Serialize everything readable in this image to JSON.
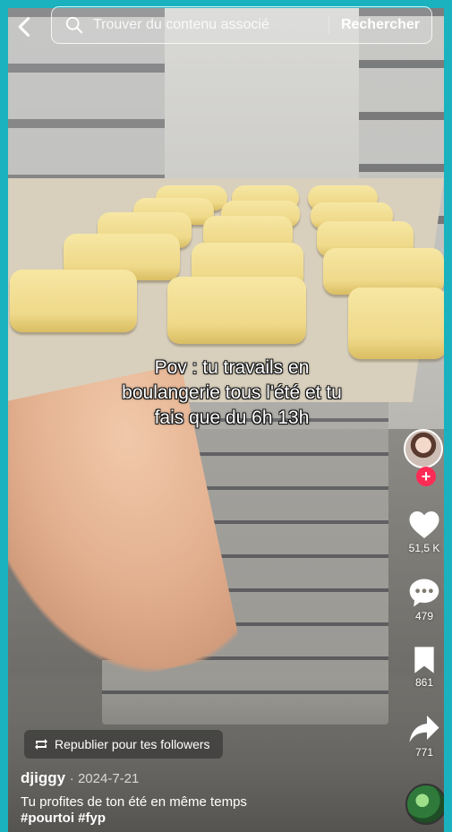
{
  "search": {
    "placeholder": "Trouver du contenu associé",
    "button_label": "Rechercher"
  },
  "video": {
    "caption_lines": [
      "Pov : tu travails en",
      "boulangerie tous l'été et tu",
      "fais que du 6h 13h"
    ]
  },
  "actions": {
    "likes": "51,5 K",
    "comments": "479",
    "saves": "861",
    "shares": "771"
  },
  "repost": {
    "label": "Republier pour tes followers"
  },
  "post": {
    "author": "djiggy",
    "date": "· 2024-7-21",
    "description": "Tu profites de ton été en même temps",
    "hashtags": "#pourtoi #fyp"
  },
  "colors": {
    "border": "#1ab2bf",
    "follow_badge": "#fe2c55"
  }
}
